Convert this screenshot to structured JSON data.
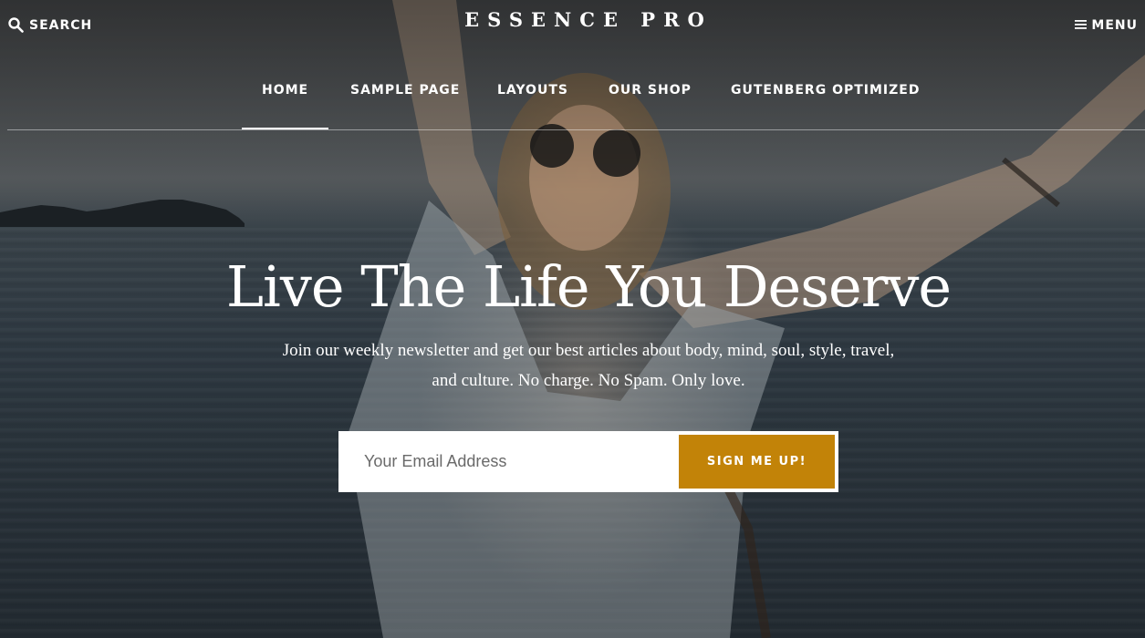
{
  "header": {
    "search_label": "SEARCH",
    "site_title": "ESSENCE PRO",
    "menu_label": "MENU"
  },
  "nav": {
    "items": [
      {
        "label": "HOME",
        "active": true
      },
      {
        "label": "SAMPLE PAGE",
        "active": false
      },
      {
        "label": "LAYOUTS",
        "active": false
      },
      {
        "label": "OUR SHOP",
        "active": false
      },
      {
        "label": "GUTENBERG OPTIMIZED",
        "active": false
      }
    ]
  },
  "hero": {
    "headline": "Live The Life You Deserve",
    "subtext": "Join our weekly newsletter and get our best articles about body, mind, soul, style, travel, and culture. No charge. No Spam. Only love."
  },
  "newsletter": {
    "email_placeholder": "Your Email Address",
    "submit_label": "SIGN ME UP!"
  },
  "colors": {
    "accent": "#c28308",
    "text": "#ffffff"
  },
  "icons": {
    "search": "search-icon",
    "menu": "hamburger-icon"
  }
}
